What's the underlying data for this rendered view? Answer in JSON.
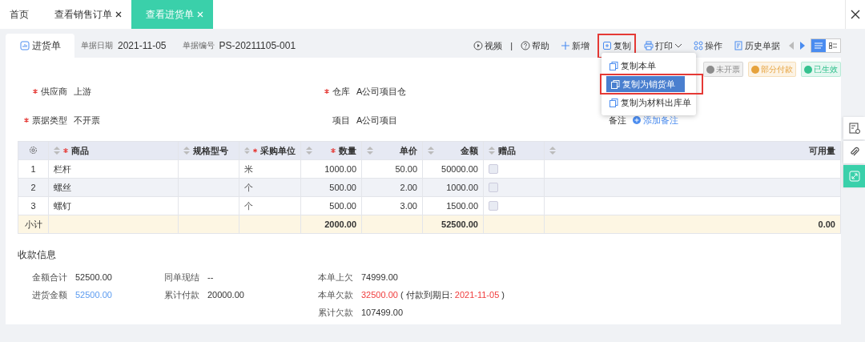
{
  "tabs": [
    {
      "label": "首页",
      "closable": false,
      "selected": false
    },
    {
      "label": "查看销售订单",
      "closable": true,
      "selected": false
    },
    {
      "label": "查看进货单",
      "closable": true,
      "selected": true
    }
  ],
  "doc": {
    "title": "进货单",
    "meta": [
      {
        "label": "单据日期",
        "value": "2021-11-05"
      },
      {
        "label": "单据编号",
        "value": "PS-20211105-001"
      }
    ]
  },
  "toolbar": {
    "items": [
      {
        "kind": "video",
        "label": "视频",
        "highlighted": false
      },
      {
        "kind": "separator",
        "label": "|"
      },
      {
        "kind": "help",
        "label": "帮助",
        "highlighted": false
      },
      {
        "kind": "add",
        "label": "新增",
        "highlighted": false
      },
      {
        "kind": "copy",
        "label": "复制",
        "highlighted": true
      },
      {
        "kind": "print",
        "label": "打印",
        "highlighted": false
      },
      {
        "kind": "ops",
        "label": "操作",
        "highlighted": false
      },
      {
        "kind": "history",
        "label": "历史单据",
        "highlighted": false
      }
    ],
    "views": [
      {
        "kind": "list",
        "selected": true
      },
      {
        "kind": "detail",
        "selected": false
      }
    ]
  },
  "copy_menu": {
    "items": [
      {
        "label": "复制本单",
        "selected": false,
        "highlighted": false
      },
      {
        "label": "复制为销货单",
        "selected": true,
        "highlighted": true
      },
      {
        "label": "复制为材料出库单",
        "selected": false,
        "highlighted": false
      }
    ]
  },
  "badges": [
    {
      "label": "未开票",
      "color": "#8c8c8c"
    },
    {
      "label": "部分付款",
      "color": "#e6a23c"
    },
    {
      "label": "已生效",
      "color": "#35c28f"
    }
  ],
  "fields": [
    {
      "label": "供应商",
      "value": "上游",
      "required": true
    },
    {
      "label": "仓库",
      "value": "A公司项目仓",
      "required": true
    },
    {
      "label": "票据类型",
      "value": "不开票",
      "required": true
    },
    {
      "label": "项目",
      "value": "A公司项目",
      "required": false
    },
    {
      "label": "备注",
      "link": "添加备注",
      "required": false
    }
  ],
  "table": {
    "columns": [
      {
        "label": "商品",
        "required": true
      },
      {
        "label": "规格型号",
        "required": false
      },
      {
        "label": "采购单位",
        "required": true
      },
      {
        "label": "数量",
        "required": true
      },
      {
        "label": "单价",
        "required": false
      },
      {
        "label": "金额",
        "required": false
      },
      {
        "label": "赠品",
        "required": false
      },
      {
        "label": "可用量",
        "required": false
      }
    ],
    "rows": [
      {
        "index": "1",
        "cells": [
          "栏杆",
          "",
          "米",
          "1000.00",
          "50.00",
          "50000.00"
        ],
        "gift_checked": false
      },
      {
        "index": "2",
        "cells": [
          "螺丝",
          "",
          "个",
          "500.00",
          "2.00",
          "1000.00"
        ],
        "gift_checked": false
      },
      {
        "index": "3",
        "cells": [
          "螺钉",
          "",
          "个",
          "500.00",
          "3.00",
          "1500.00"
        ],
        "gift_checked": false
      }
    ],
    "subtotal": {
      "label": "小计",
      "quantity": "2000.00",
      "amount": "52500.00",
      "available": "0.00"
    }
  },
  "payment": {
    "title": "收款信息",
    "columns": [
      [
        {
          "label": "金额合计",
          "parts": [
            {
              "text": "52500.00",
              "kind": "plain"
            }
          ]
        },
        {
          "label": "进货金额",
          "parts": [
            {
              "text": "52500.00",
              "kind": "link"
            }
          ]
        }
      ],
      [
        {
          "label": "同单现结",
          "parts": [
            {
              "text": "--",
              "kind": "plain"
            }
          ]
        },
        {
          "label": "累计付款",
          "parts": [
            {
              "text": "20000.00",
              "kind": "plain"
            }
          ]
        }
      ],
      [
        {
          "label": "本单上欠",
          "parts": [
            {
              "text": "74999.00",
              "kind": "plain"
            }
          ]
        },
        {
          "label": "本单欠款",
          "parts": [
            {
              "text": "32500.00",
              "kind": "danger"
            },
            {
              "text": "( 付款到期日:",
              "kind": "plain"
            },
            {
              "text": "2021-11-05",
              "kind": "danger"
            },
            {
              "text": ")",
              "kind": "plain"
            }
          ]
        },
        {
          "label": "累计欠款",
          "parts": [
            {
              "text": "107499.00",
              "kind": "plain"
            }
          ]
        }
      ]
    ]
  },
  "side_tools": [
    {
      "kind": "note",
      "active": false
    },
    {
      "kind": "attach",
      "active": false
    },
    {
      "kind": "expand",
      "active": true
    }
  ]
}
